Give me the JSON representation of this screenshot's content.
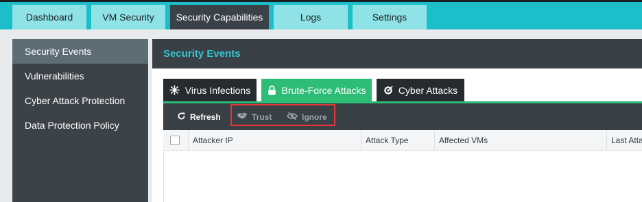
{
  "top_nav": {
    "tabs": [
      {
        "label": "Dashboard"
      },
      {
        "label": "VM Security"
      },
      {
        "label": "Security Capabilities",
        "active": true
      },
      {
        "label": "Logs"
      },
      {
        "label": "Settings"
      }
    ]
  },
  "sidebar": {
    "items": [
      {
        "label": "Security Events",
        "active": true
      },
      {
        "label": "Vulnerabilities"
      },
      {
        "label": "Cyber Attack Protection"
      },
      {
        "label": "Data Protection Policy"
      }
    ]
  },
  "main": {
    "title": "Security Events",
    "tabs": [
      {
        "label": "Virus Infections",
        "icon": "virus-icon"
      },
      {
        "label": "Brute-Force Attacks",
        "icon": "lock-icon",
        "active": true
      },
      {
        "label": "Cyber Attacks",
        "icon": "target-icon"
      }
    ],
    "toolbar": {
      "refresh_label": "Refresh",
      "trust_label": "Trust",
      "ignore_label": "Ignore"
    },
    "table": {
      "columns": [
        "Attacker IP",
        "Attack Type",
        "Affected VMs",
        "Last Attac"
      ],
      "rows": []
    }
  },
  "colors": {
    "accent": "#1cbfc9",
    "active_subtab": "#2ebd76",
    "highlight_border": "#e8363a"
  }
}
